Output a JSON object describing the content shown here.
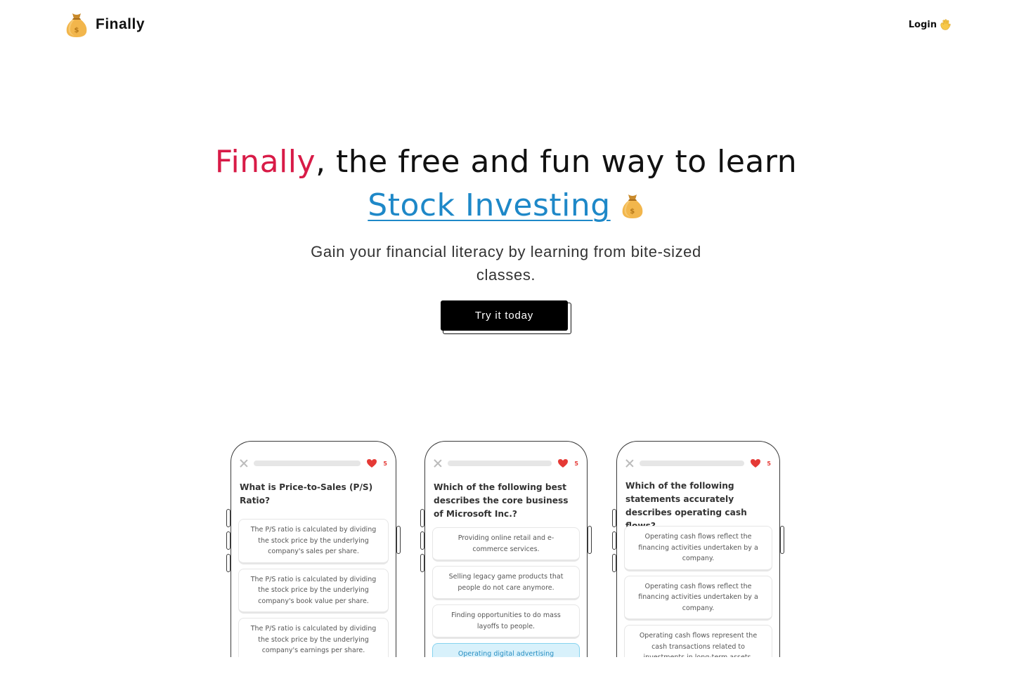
{
  "header": {
    "brand_name": "Finally",
    "logo_icon": "money-bag-icon",
    "login_label": "Login",
    "login_icon": "waving-hand-icon"
  },
  "hero": {
    "headline_accent": "Finally",
    "headline_rest": ", the free and fun way to learn",
    "headline_link": "Stock Investing",
    "headline_icon": "money-bag-icon",
    "subtitle": "Gain your financial literacy by learning from bite-sized classes.",
    "cta_label": "Try it today"
  },
  "colors": {
    "accent_red": "#d81b47",
    "link_blue": "#1e88c8",
    "cta_bg": "#000000",
    "heart_red": "#e53935",
    "selected_bg": "#d8f1fb"
  },
  "phones": [
    {
      "lives": "5",
      "question": "What is Price-to-Sales (P/S) Ratio?",
      "options": [
        "The P/S ratio is calculated by dividing the stock price by the underlying company's sales per share.",
        "The P/S ratio is calculated by dividing the stock price by the underlying company's book value per share.",
        "The P/S ratio is calculated by dividing the stock price by the underlying company's earnings per share."
      ]
    },
    {
      "lives": "5",
      "question": "Which of the following best describes the core business of Microsoft Inc.?",
      "options": [
        "Providing online retail and e-commerce services.",
        "Selling legacy game products that people do not care anymore.",
        "Finding opportunities to do mass layoffs to people.",
        "Operating digital advertising platforms and services."
      ]
    },
    {
      "lives": "5",
      "question": "Which of the following statements accurately describes operating cash flows?",
      "options": [
        "Operating cash flows reflect the financing activities undertaken by a company.",
        "Operating cash flows reflect the financing activities undertaken by a company.",
        "Operating cash flows represent the cash transactions related to investments in long-term assets."
      ]
    }
  ]
}
